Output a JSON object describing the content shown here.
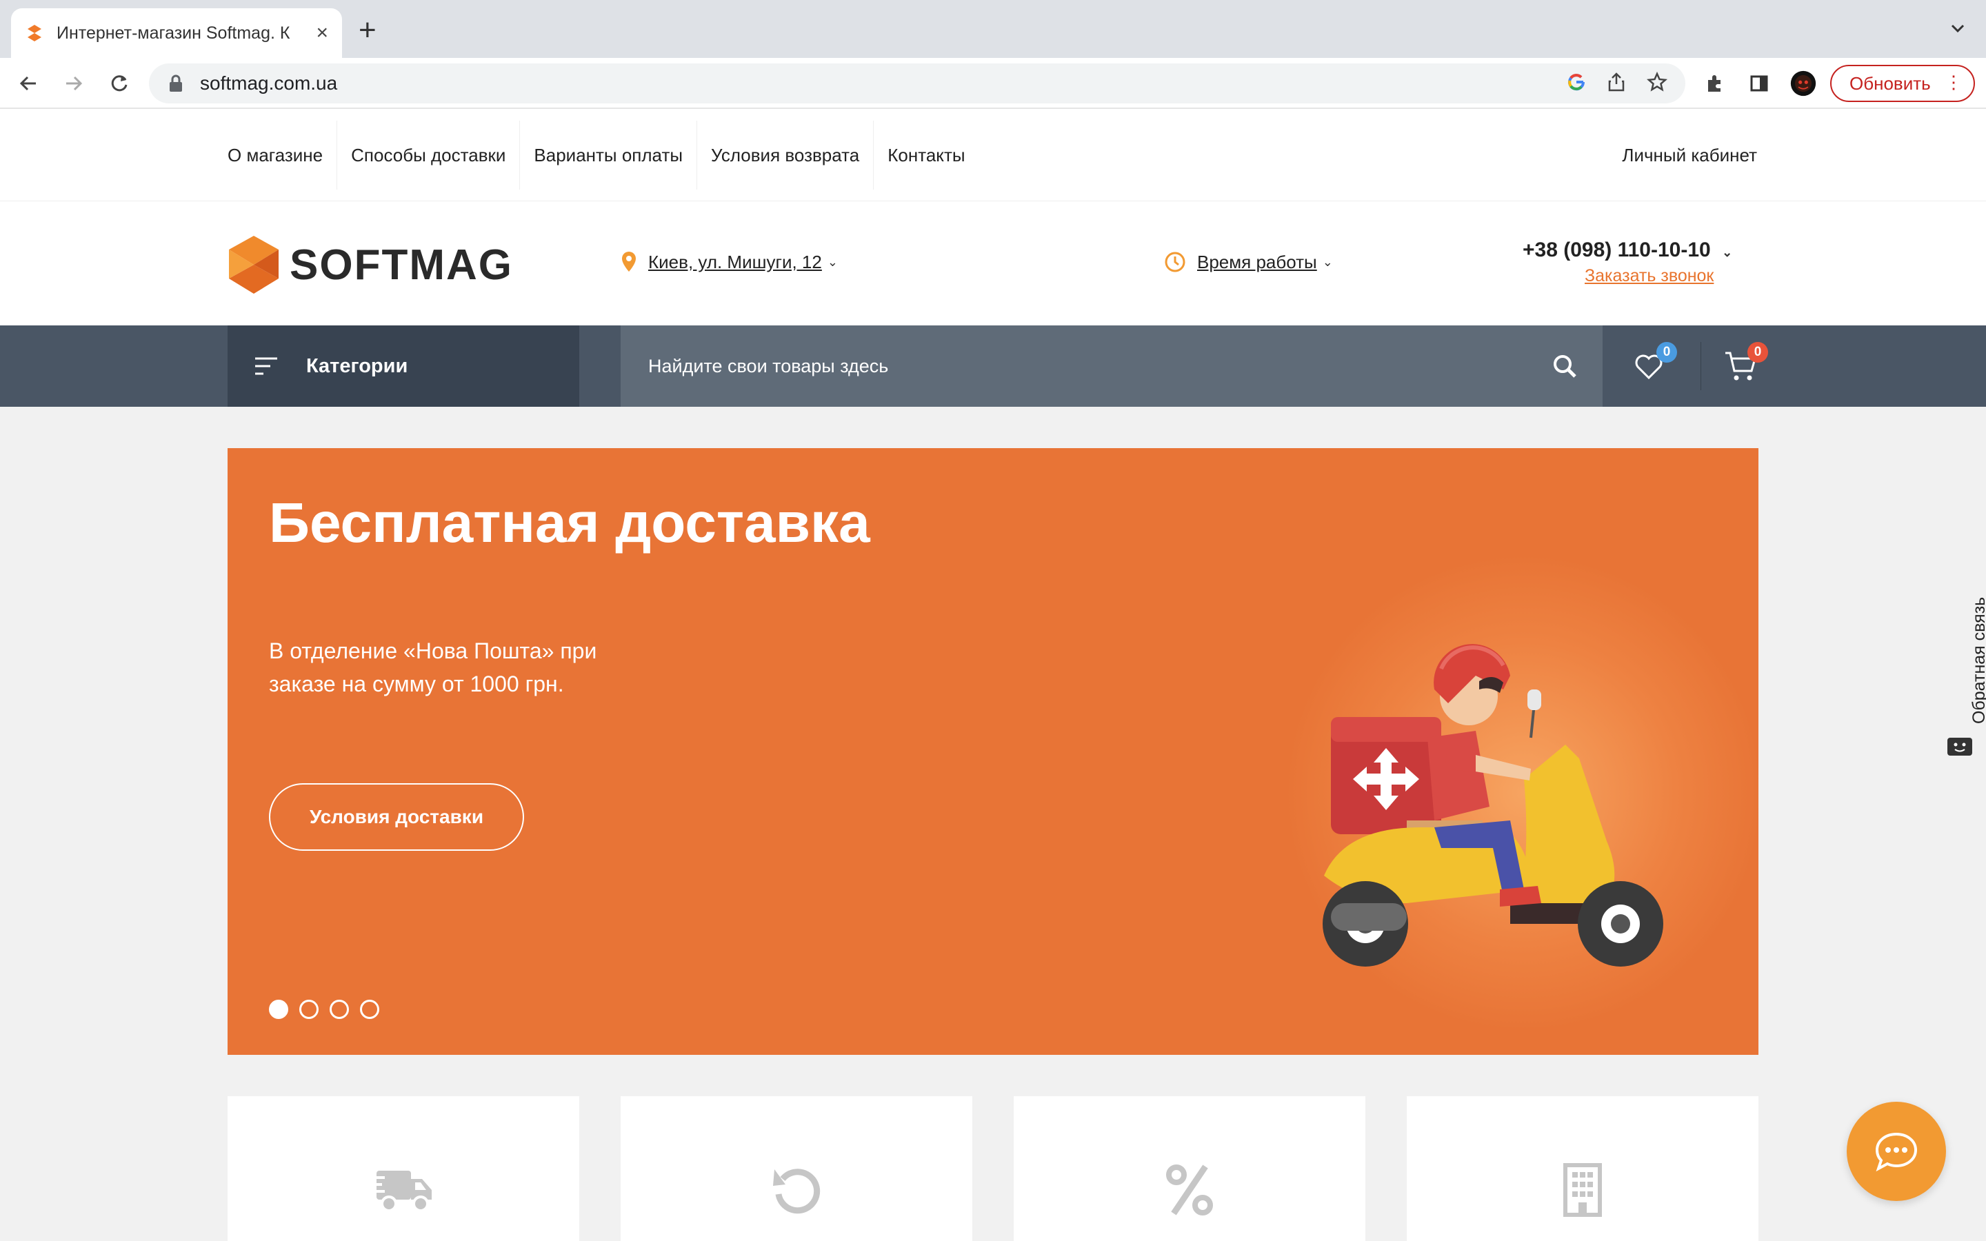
{
  "browser": {
    "tab_title": "Интернет-магазин Softmag. К",
    "url": "softmag.com.ua",
    "update_label": "Обновить"
  },
  "topmenu": {
    "links": [
      "О магазине",
      "Способы доставки",
      "Варианты оплаты",
      "Условия возврата",
      "Контакты"
    ],
    "account": "Личный кабинет"
  },
  "header": {
    "logo_text": "SOFTMAG",
    "address": "Киев, ул. Мишуги, 12",
    "hours": "Время работы",
    "phone": "+38 (098) 110-10-10",
    "callback": "Заказать звонок"
  },
  "navbar": {
    "categories": "Категории",
    "search_placeholder": "Найдите свои товары здесь",
    "wishlist_count": "0",
    "cart_count": "0"
  },
  "hero": {
    "title": "Бесплатная доставка",
    "subtitle": "В отделение «Нова Пошта» при заказе на сумму от 1000 грн.",
    "button": "Условия доставки",
    "slides_total": 4,
    "active_slide": 1
  },
  "features": {
    "icons": [
      "truck-icon",
      "return-icon",
      "percent-icon",
      "building-icon"
    ]
  },
  "feedback": {
    "label": "Обратная связь"
  },
  "colors": {
    "accent": "#e87436",
    "navbar": "#4a5665",
    "wishlist_badge": "#4a9be0",
    "cart_badge": "#e8533a"
  }
}
